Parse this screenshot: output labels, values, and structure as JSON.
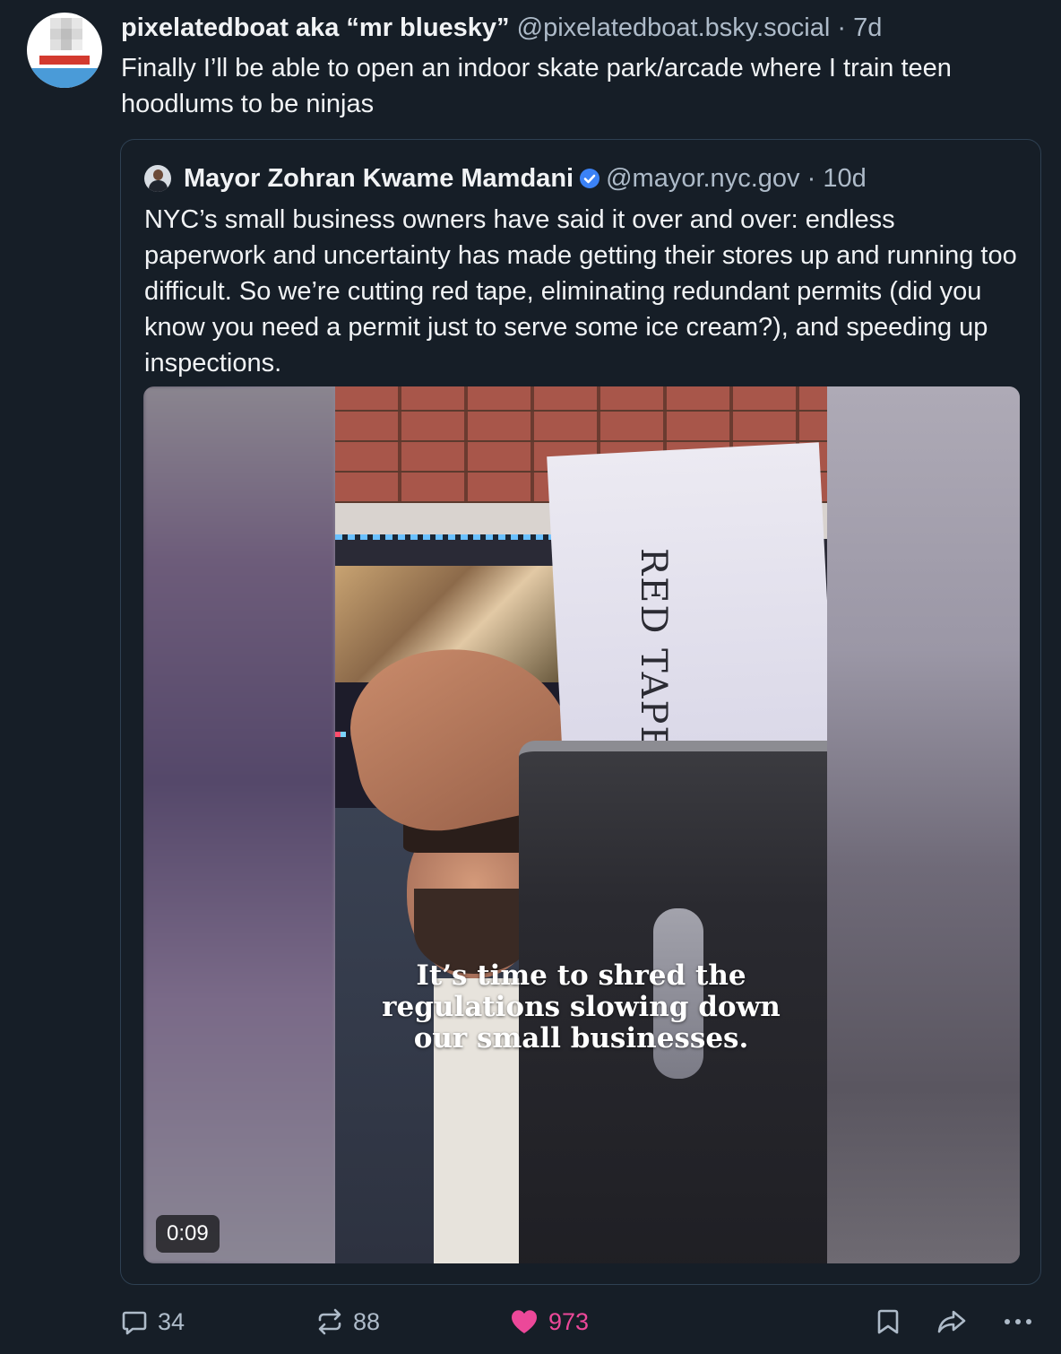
{
  "post": {
    "author_name": "pixelatedboat aka “mr bluesky”",
    "author_handle": "@pixelatedboat.bsky.social",
    "separator": "·",
    "time": "7d",
    "text": "Finally I’ll be able to open an indoor skate park/arcade where I train teen hoodlums to be ninjas"
  },
  "quote": {
    "author_name": "Mayor Zohran Kwame Mamdani",
    "verified": true,
    "author_handle": "@mayor.nyc.gov",
    "separator": "·",
    "time": "10d",
    "text": "NYC’s small business owners have said it over and over: endless paperwork and uncertainty has made getting their stores up and running too difficult. So we’re cutting red tape, eliminating redundant permits (did you know you need a permit just to serve some ice cream?), and speeding up inspections.",
    "video": {
      "paper_label": "RED TAPE",
      "caption_line1": "It’s time to shred the",
      "caption_line2": "regulations slowing down",
      "caption_line3": "our small businesses.",
      "duration": "0:09"
    }
  },
  "actions": {
    "reply_count": "34",
    "repost_count": "88",
    "like_count": "973",
    "like_color": "#ec4899",
    "icons": [
      "reply-icon",
      "repost-icon",
      "heart-icon",
      "bookmark-icon",
      "share-icon",
      "more-icon"
    ]
  },
  "colors": {
    "background": "#161e27",
    "text": "#f1f3f5",
    "muted": "#aebbc9",
    "verified": "#3b82f6",
    "border": "#2e4052"
  }
}
